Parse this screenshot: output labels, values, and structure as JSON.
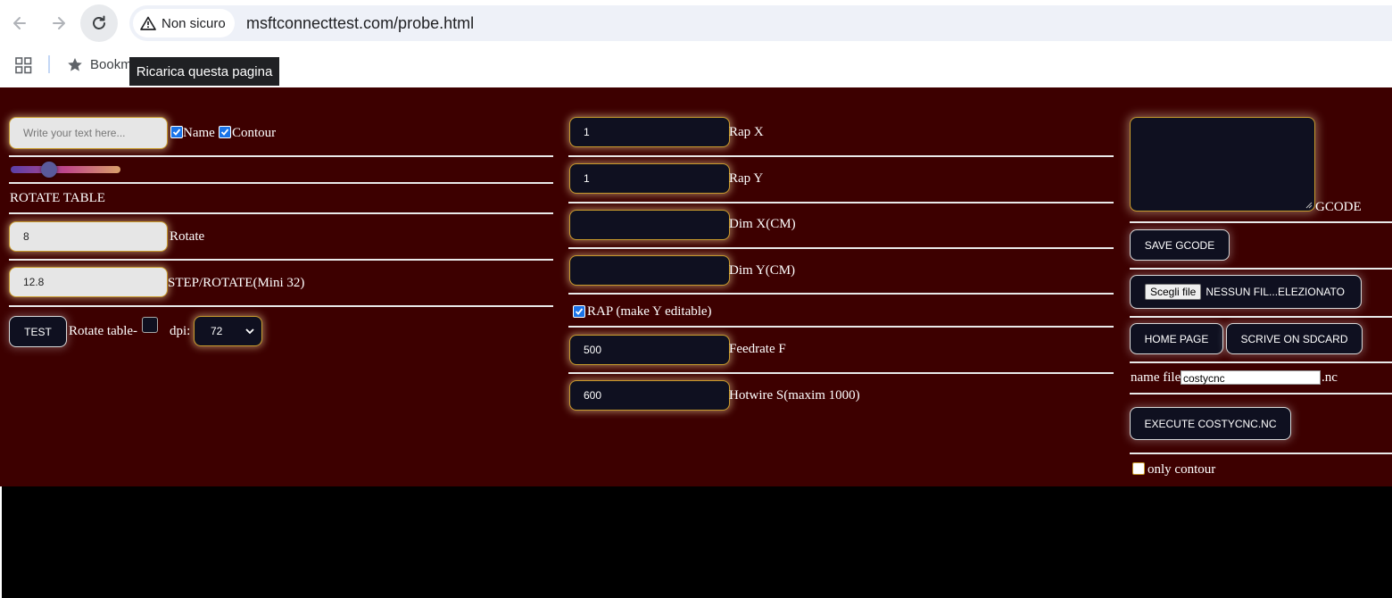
{
  "browser": {
    "security_label": "Non sicuro",
    "url": "msftconnecttest.com/probe.html",
    "bookmark_label": "Bookm",
    "tooltip": "Ricarica questa pagina"
  },
  "left": {
    "text_placeholder": "Write your text here...",
    "name_label": "Name",
    "contour_label": "Contour",
    "name_checked": true,
    "contour_checked": true,
    "slider_fraction": 0.32,
    "rotate_table_heading": "ROTATE TABLE",
    "rotate_value": "8",
    "rotate_label": "Rotate",
    "step_value": "12.8",
    "step_label": "STEP/ROTATE(Mini 32)",
    "test_button": "TEST",
    "rotate_table_label": "Rotate table-",
    "dpi_label": "dpi:",
    "dpi_value": "72"
  },
  "middle": {
    "rap_x_value": "1",
    "rap_x_label": "Rap X",
    "rap_y_value": "1",
    "rap_y_label": "Rap Y",
    "dim_x_value": "",
    "dim_x_label": "Dim X(CM)",
    "dim_y_value": "",
    "dim_y_label": "Dim Y(CM)",
    "rap_checkbox_label": "RAP (make Y editable)",
    "rap_checked": true,
    "feedrate_value": "500",
    "feedrate_label": "Feedrate F",
    "hotwire_value": "600",
    "hotwire_label": "Hotwire S(maxim 1000)"
  },
  "right": {
    "gcode_label": "GCODE",
    "save_button": "SAVE GCODE",
    "choose_file_button": "Scegli file",
    "no_file_text": "NESSUN FIL...ELEZIONATO",
    "home_button": "HOME PAGE",
    "sdcard_button": "SCRIVE ON SDCARD",
    "name_file_label": "name file",
    "name_file_value": "costycnc",
    "name_file_ext": ".nc",
    "execute_button": "EXECUTE COSTYCNC.NC",
    "only_contour_label": "only contour",
    "only_contour_checked": false
  },
  "colors": {
    "page_bg": "#3d0000",
    "canvas_bg": "#000000",
    "input_glow_border": "#c79a2c",
    "dark_input_bg": "#0f1020"
  }
}
